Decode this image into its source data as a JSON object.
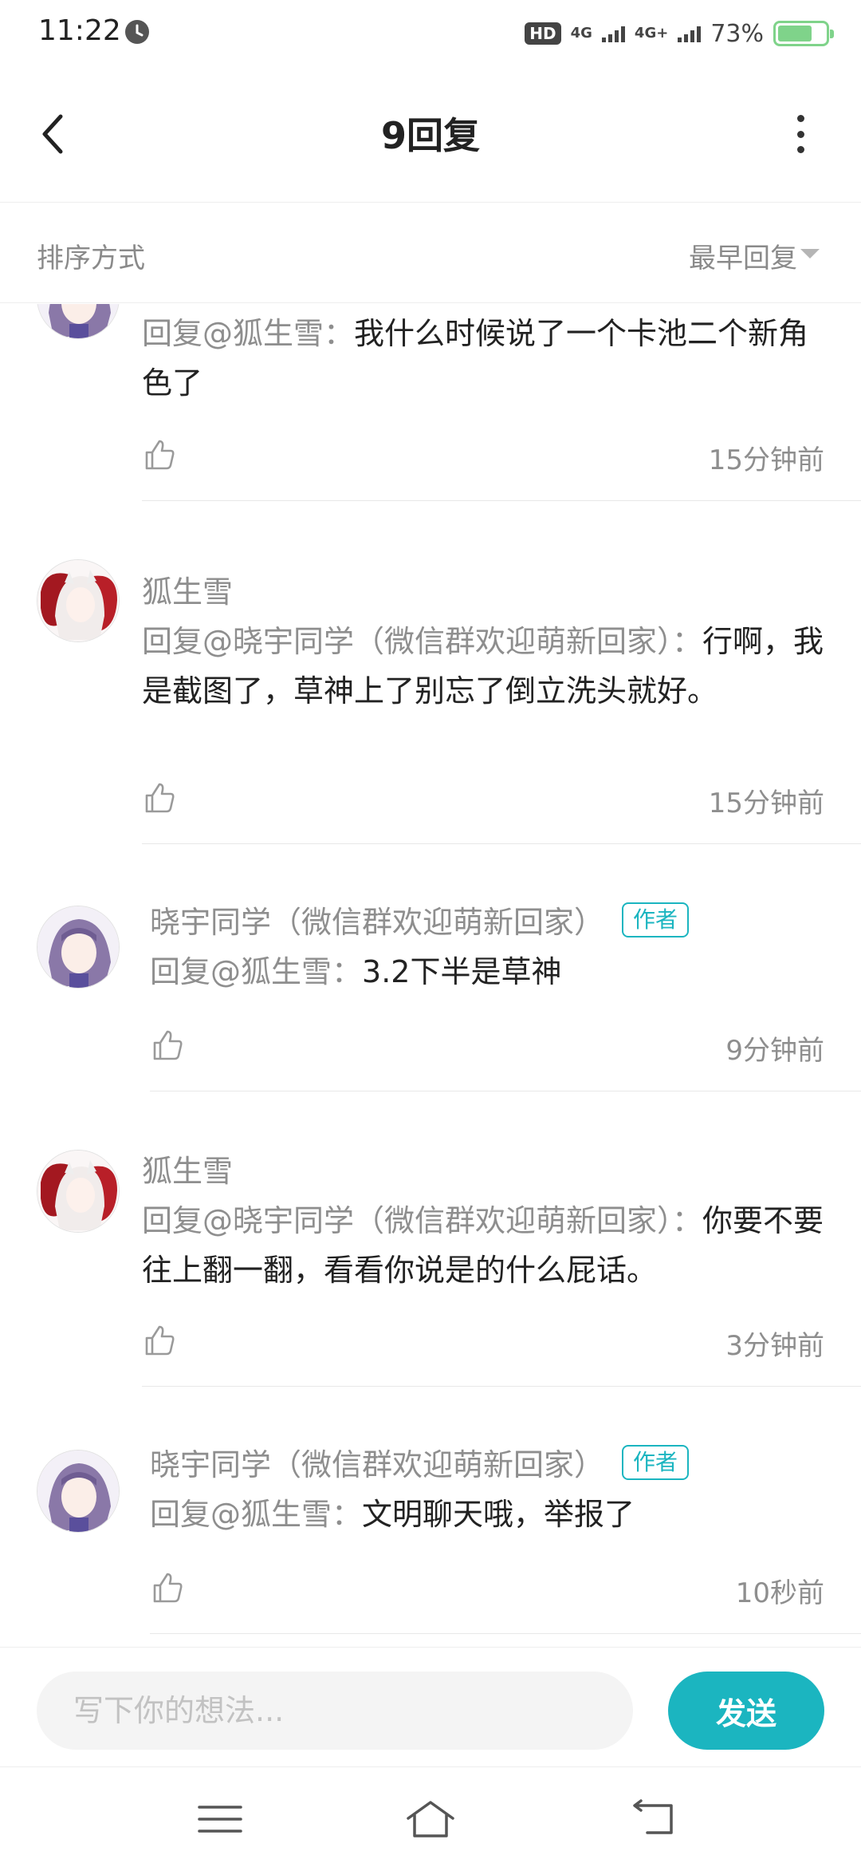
{
  "status_bar": {
    "time": "11:22",
    "hd": "HD",
    "net1": "4G",
    "net2": "4G+",
    "battery_percent": "73%",
    "battery_level": 0.73,
    "icons": [
      "clock-icon",
      "signal-icon",
      "battery-icon"
    ]
  },
  "header": {
    "title": "9回复"
  },
  "sort": {
    "label": "排序方式",
    "value": "最早回复"
  },
  "replies": [
    {
      "avatar": "avatar-purple-hair",
      "name": "",
      "is_author": false,
      "mention": "回复@狐生雪：",
      "text": "我什么时候说了一个卡池二个新角色了",
      "time": "15分钟前"
    },
    {
      "avatar": "avatar-white-hair-red",
      "name": "狐生雪",
      "is_author": false,
      "mention": "回复@晓宇同学（微信群欢迎萌新回家）：",
      "text": "行啊，我是截图了，草神上了别忘了倒立洗头就好。",
      "time": "15分钟前"
    },
    {
      "avatar": "avatar-purple-hair",
      "name": "晓宇同学（微信群欢迎萌新回家）",
      "is_author": true,
      "author_badge": "作者",
      "mention": "回复@狐生雪：",
      "text": "3.2下半是草神",
      "time": "9分钟前"
    },
    {
      "avatar": "avatar-white-hair-red",
      "name": "狐生雪",
      "is_author": false,
      "mention": "回复@晓宇同学（微信群欢迎萌新回家）：",
      "text": "你要不要往上翻一翻，看看你说是的什么屁话。",
      "time": "3分钟前"
    },
    {
      "avatar": "avatar-purple-hair",
      "name": "晓宇同学（微信群欢迎萌新回家）",
      "is_author": true,
      "author_badge": "作者",
      "mention": "回复@狐生雪：",
      "text": "文明聊天哦，举报了",
      "time": "10秒前"
    }
  ],
  "input": {
    "placeholder": "写下你的想法...",
    "value": "",
    "send_label": "发送"
  },
  "colors": {
    "accent": "#1bb5c0",
    "muted_text": "#8e8e8e",
    "body_text": "#222222",
    "battery": "#7fd38a"
  }
}
